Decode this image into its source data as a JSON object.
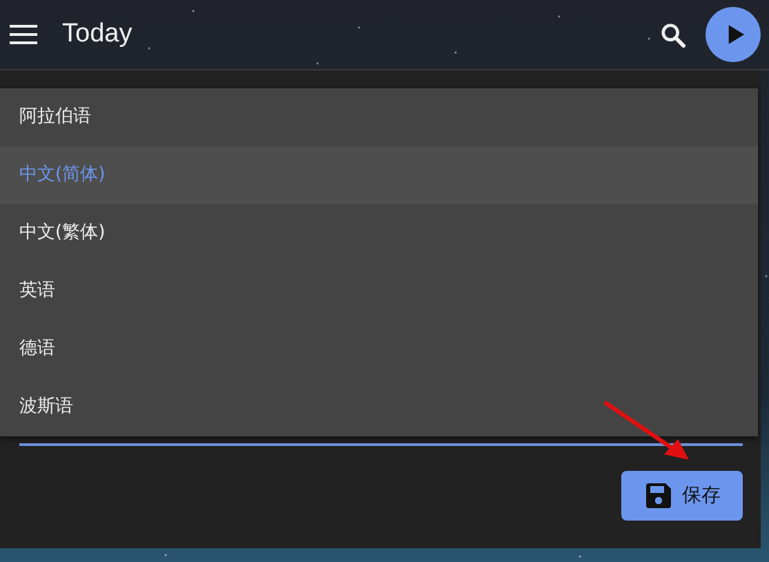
{
  "app_bar": {
    "title": "Today"
  },
  "language_select": {
    "expanded": true,
    "options": [
      {
        "label": "阿拉伯语",
        "selected": false
      },
      {
        "label": "中文(简体)",
        "selected": true
      },
      {
        "label": "中文(繁体)",
        "selected": false
      },
      {
        "label": "英语",
        "selected": false
      },
      {
        "label": "德语",
        "selected": false
      },
      {
        "label": "波斯语",
        "selected": false
      }
    ]
  },
  "save_button": {
    "label": "保存"
  }
}
